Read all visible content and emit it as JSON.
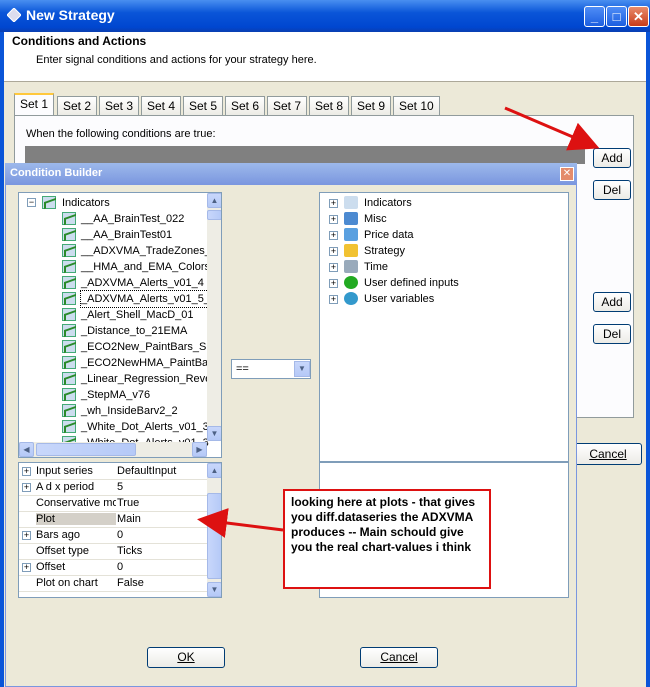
{
  "window": {
    "title": "New Strategy"
  },
  "header": {
    "title": "Conditions and Actions",
    "subtitle": "Enter signal conditions and actions for your strategy here."
  },
  "tabs": [
    "Set 1",
    "Set 2",
    "Set 3",
    "Set 4",
    "Set 5",
    "Set 6",
    "Set 7",
    "Set 8",
    "Set 9",
    "Set 10"
  ],
  "panel": {
    "conditions_label": "When the following conditions are true:"
  },
  "buttons": {
    "add": "Add",
    "del": "Del",
    "add2": "Add",
    "del2": "Del",
    "cancel": "Cancel"
  },
  "condition_builder": {
    "title": "Condition Builder",
    "left_tree": {
      "root": "Indicators",
      "items": [
        "__AA_BrainTest_022",
        "__AA_BrainTest01",
        "__ADXVMA_TradeZones_",
        "__HMA_and_EMA_Colors",
        "_ADXVMA_Alerts_v01_4",
        "_ADXVMA_Alerts_v01_5_",
        "_Alert_Shell_MacD_01",
        "_Distance_to_21EMA",
        "_ECO2New_PaintBars_Sh",
        "_ECO2NewHMA_PaintBa",
        "_Linear_Regression_Reve",
        "_StepMA_v76",
        "_wh_InsideBarv2_2",
        "_White_Dot_Alerts_v01_3",
        "_White_Dot_Alerts_v01_3"
      ]
    },
    "operator": "==",
    "right_tree": [
      "Indicators",
      "Misc",
      "Price data",
      "Strategy",
      "Time",
      "User defined inputs",
      "User variables"
    ],
    "properties": [
      {
        "name": "Input series",
        "value": "DefaultInput",
        "expand": true
      },
      {
        "name": "A d x period",
        "value": "5",
        "expand": true
      },
      {
        "name": "Conservative mo",
        "value": "True",
        "expand": false
      },
      {
        "name": "Plot",
        "value": "Main",
        "expand": false
      },
      {
        "name": "Bars ago",
        "value": "0",
        "expand": true
      },
      {
        "name": "Offset type",
        "value": "Ticks",
        "expand": false
      },
      {
        "name": "Offset",
        "value": "0",
        "expand": true
      },
      {
        "name": "Plot on chart",
        "value": "False",
        "expand": false
      }
    ],
    "ok": "OK",
    "cancel": "Cancel"
  },
  "annotation": {
    "text": "looking here at plots - that gives you diff.dataseries the ADXVMA produces -- Main schould give you the real chart-values i think"
  },
  "colors": {
    "titlebar": "#0a55d8",
    "annotation_border": "#dd1111",
    "arrow": "#dd1111"
  }
}
